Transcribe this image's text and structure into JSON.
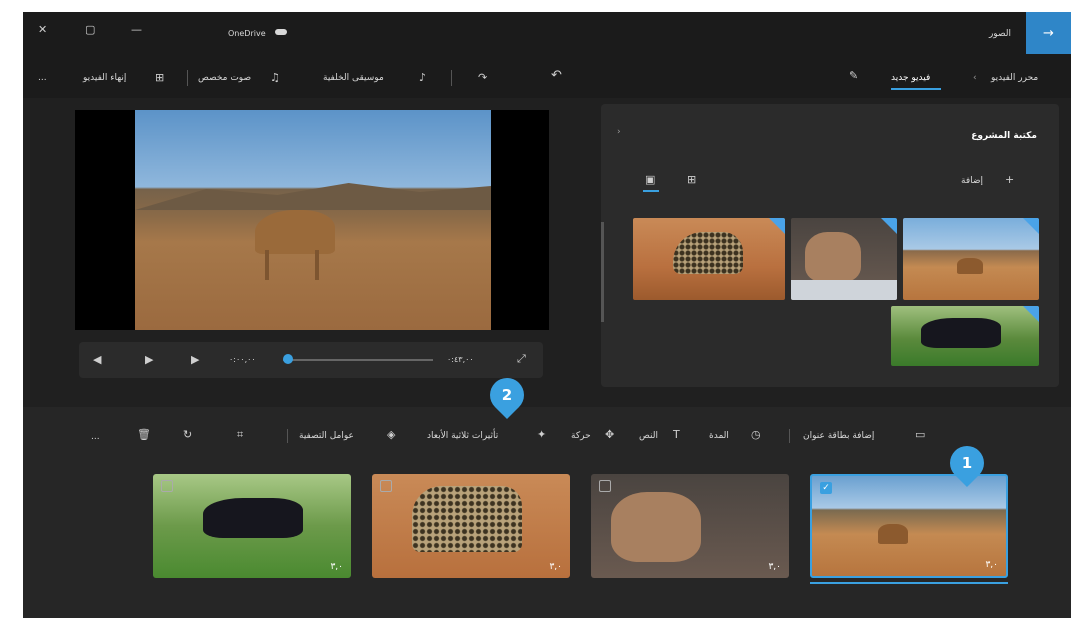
{
  "window": {
    "title": "OneDrive",
    "app_name": "الصور",
    "controls": {
      "close": "✕",
      "maximize": "▢",
      "minimize": "—"
    }
  },
  "header": {
    "breadcrumb_root": "محرر الفيديو",
    "breadcrumb_current": "فيديو جديد",
    "finish_label": "إنهاء الفيديو",
    "custom_audio_label": "صوت مخصص",
    "background_music_label": "موسيقى الخلفية",
    "more_label": "..."
  },
  "library": {
    "title": "مكتبة المشروع",
    "add_label": "إضافة"
  },
  "player": {
    "time_current": "٠:٠٠,٠٠",
    "time_total": "٠:٤٣,٠٠",
    "progress": 0.0
  },
  "storyboard": {
    "tools": {
      "add_title_card": "إضافة بطاقة عنوان",
      "duration": "المدة",
      "text": "النص",
      "motion": "حركة",
      "3d_effects": "تأثيرات ثلاثية الأبعاد",
      "filters": "عوامل التصفية",
      "more": "..."
    },
    "clips": [
      {
        "duration": "٣,٠",
        "selected": true
      },
      {
        "duration": "٣,٠",
        "selected": false
      },
      {
        "duration": "٣,٠",
        "selected": false
      },
      {
        "duration": "٣,٠",
        "selected": false
      }
    ]
  },
  "callouts": {
    "one": "1",
    "two": "2"
  },
  "colors": {
    "accent": "#3aa0e0",
    "background": "#202020",
    "panel": "#2b2b2b"
  }
}
